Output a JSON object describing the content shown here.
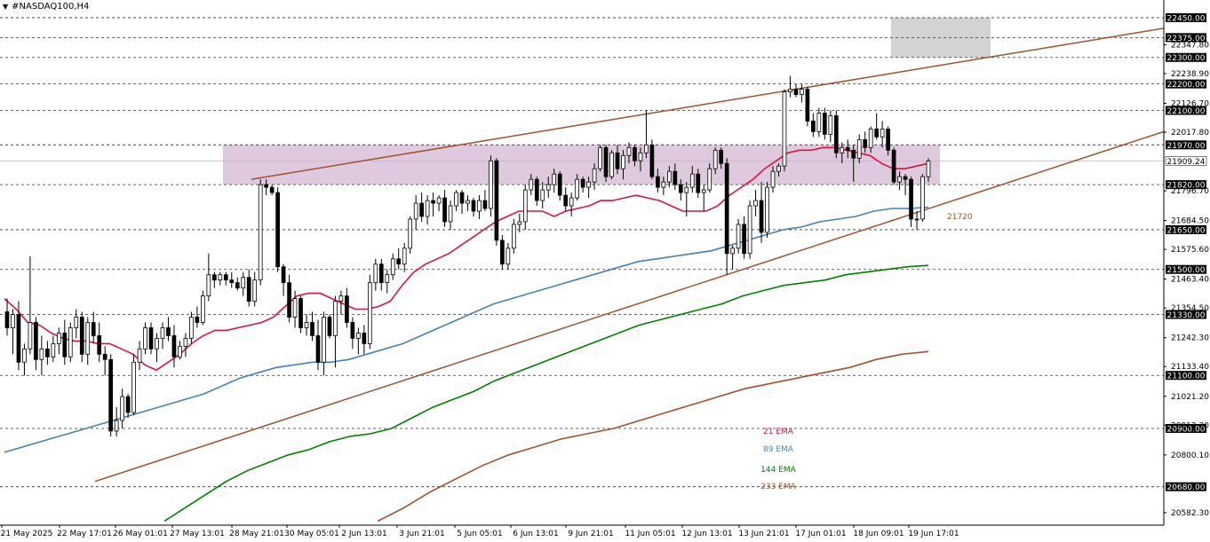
{
  "window": {
    "title": "#NASDAQ100,H4"
  },
  "colors": {
    "bull_fill": "#ffffff",
    "bear_fill": "#000000",
    "candle_line": "#000000",
    "grid": "#333333",
    "ema21": "#dc143c",
    "ema89": "#4682b4",
    "ema144": "#008000",
    "ema233": "#a0522d",
    "channel": "#a0522d",
    "zone_purple": "#d8bfd8",
    "zone_grey": "#d3d3d3",
    "price_box": "#000000"
  },
  "chart_data": {
    "type": "candlestick",
    "title": "#NASDAQ100,H4",
    "ylim": [
      20535,
      22500
    ],
    "y_ticks": [
      "22347.80",
      "22238.90",
      "22126.70",
      "22017.80",
      "21796.70",
      "21684.50",
      "21575.60",
      "21463.40",
      "21354.50",
      "21242.30",
      "21133.40",
      "21021.20",
      "20912.30",
      "20800.10",
      "20582.30"
    ],
    "price_levels": [
      "22450.00",
      "22375.00",
      "22300.00",
      "22200.00",
      "22100.00",
      "21970.00",
      "21820.00",
      "21650.00",
      "21500.00",
      "21330.00",
      "21100.00",
      "20900.00",
      "20680.00"
    ],
    "current_price": "21909.24",
    "x_labels": [
      "21 May 2025",
      "22 May 17:01",
      "26 May 01:01",
      "27 May 13:01",
      "28 May 21:01",
      "30 May 05:01",
      "2 Jun 13:01",
      "3 Jun 21:01",
      "5 Jun 05:01",
      "6 Jun 13:01",
      "9 Jun 21:01",
      "11 Jun 05:01",
      "12 Jun 13:01",
      "13 Jun 21:01",
      "17 Jun 01:01",
      "18 Jun 09:01",
      "19 Jun 17:01"
    ],
    "candles": [
      [
        21340,
        21390,
        21250,
        21280
      ],
      [
        21280,
        21350,
        21180,
        21330
      ],
      [
        21330,
        21380,
        21120,
        21150
      ],
      [
        21150,
        21220,
        21100,
        21200
      ],
      [
        21200,
        21550,
        21180,
        21300
      ],
      [
        21300,
        21320,
        21120,
        21160
      ],
      [
        21160,
        21250,
        21100,
        21200
      ],
      [
        21200,
        21230,
        21140,
        21170
      ],
      [
        21170,
        21250,
        21150,
        21220
      ],
      [
        21220,
        21280,
        21180,
        21260
      ],
      [
        21260,
        21310,
        21140,
        21170
      ],
      [
        21170,
        21300,
        21150,
        21280
      ],
      [
        21280,
        21350,
        21240,
        21320
      ],
      [
        21320,
        21340,
        21150,
        21180
      ],
      [
        21180,
        21320,
        21140,
        21300
      ],
      [
        21300,
        21340,
        21220,
        21250
      ],
      [
        21250,
        21300,
        21150,
        21180
      ],
      [
        21180,
        21210,
        21100,
        21160
      ],
      [
        21160,
        21180,
        20870,
        20890
      ],
      [
        20890,
        20980,
        20870,
        20930
      ],
      [
        20930,
        21050,
        20900,
        21020
      ],
      [
        21020,
        21030,
        20940,
        20960
      ],
      [
        20960,
        21180,
        20950,
        21150
      ],
      [
        21150,
        21230,
        21120,
        21200
      ],
      [
        21200,
        21300,
        21180,
        21280
      ],
      [
        21280,
        21300,
        21180,
        21200
      ],
      [
        21200,
        21260,
        21150,
        21240
      ],
      [
        21240,
        21300,
        21200,
        21280
      ],
      [
        21280,
        21320,
        21230,
        21250
      ],
      [
        21250,
        21290,
        21130,
        21170
      ],
      [
        21170,
        21230,
        21160,
        21210
      ],
      [
        21210,
        21260,
        21170,
        21240
      ],
      [
        21240,
        21340,
        21220,
        21320
      ],
      [
        21320,
        21360,
        21280,
        21300
      ],
      [
        21300,
        21420,
        21290,
        21400
      ],
      [
        21400,
        21560,
        21380,
        21480
      ],
      [
        21480,
        21490,
        21430,
        21460
      ],
      [
        21460,
        21490,
        21440,
        21480
      ],
      [
        21480,
        21490,
        21440,
        21460
      ],
      [
        21460,
        21490,
        21430,
        21450
      ],
      [
        21450,
        21470,
        21420,
        21430
      ],
      [
        21430,
        21490,
        21400,
        21470
      ],
      [
        21470,
        21500,
        21360,
        21380
      ],
      [
        21380,
        21490,
        21360,
        21460
      ],
      [
        21460,
        21840,
        21440,
        21820
      ],
      [
        21820,
        21840,
        21780,
        21810
      ],
      [
        21810,
        21820,
        21780,
        21790
      ],
      [
        21790,
        21810,
        21490,
        21510
      ],
      [
        21510,
        21520,
        21400,
        21450
      ],
      [
        21450,
        21480,
        21300,
        21320
      ],
      [
        21320,
        21420,
        21280,
        21390
      ],
      [
        21390,
        21400,
        21260,
        21280
      ],
      [
        21280,
        21330,
        21250,
        21300
      ],
      [
        21300,
        21340,
        21230,
        21250
      ],
      [
        21250,
        21310,
        21120,
        21150
      ],
      [
        21150,
        21340,
        21100,
        21320
      ],
      [
        21320,
        21330,
        21240,
        21250
      ],
      [
        21250,
        21400,
        21130,
        21380
      ],
      [
        21380,
        21420,
        21330,
        21400
      ],
      [
        21400,
        21430,
        21280,
        21300
      ],
      [
        21300,
        21320,
        21200,
        21240
      ],
      [
        21240,
        21280,
        21180,
        21260
      ],
      [
        21260,
        21290,
        21180,
        21220
      ],
      [
        21220,
        21480,
        21200,
        21450
      ],
      [
        21450,
        21540,
        21420,
        21520
      ],
      [
        21520,
        21540,
        21420,
        21450
      ],
      [
        21450,
        21500,
        21410,
        21480
      ],
      [
        21480,
        21560,
        21460,
        21540
      ],
      [
        21540,
        21580,
        21500,
        21520
      ],
      [
        21520,
        21600,
        21490,
        21580
      ],
      [
        21580,
        21700,
        21560,
        21690
      ],
      [
        21690,
        21780,
        21650,
        21750
      ],
      [
        21750,
        21790,
        21680,
        21700
      ],
      [
        21700,
        21780,
        21670,
        21760
      ],
      [
        21760,
        21790,
        21700,
        21750
      ],
      [
        21750,
        21780,
        21720,
        21770
      ],
      [
        21770,
        21800,
        21660,
        21680
      ],
      [
        21680,
        21760,
        21650,
        21740
      ],
      [
        21740,
        21800,
        21720,
        21790
      ],
      [
        21790,
        21800,
        21710,
        21750
      ],
      [
        21750,
        21780,
        21720,
        21760
      ],
      [
        21760,
        21770,
        21700,
        21720
      ],
      [
        21720,
        21780,
        21690,
        21760
      ],
      [
        21760,
        21800,
        21720,
        21730
      ],
      [
        21730,
        21930,
        21700,
        21910
      ],
      [
        21910,
        21920,
        21590,
        21610
      ],
      [
        21610,
        21630,
        21500,
        21520
      ],
      [
        21520,
        21600,
        21500,
        21580
      ],
      [
        21580,
        21690,
        21560,
        21670
      ],
      [
        21670,
        21710,
        21640,
        21680
      ],
      [
        21680,
        21820,
        21650,
        21800
      ],
      [
        21800,
        21860,
        21780,
        21840
      ],
      [
        21840,
        21850,
        21740,
        21760
      ],
      [
        21760,
        21830,
        21730,
        21800
      ],
      [
        21800,
        21850,
        21770,
        21820
      ],
      [
        21820,
        21880,
        21790,
        21860
      ],
      [
        21860,
        21870,
        21760,
        21780
      ],
      [
        21780,
        21810,
        21720,
        21740
      ],
      [
        21740,
        21790,
        21700,
        21770
      ],
      [
        21770,
        21860,
        21760,
        21840
      ],
      [
        21840,
        21850,
        21790,
        21810
      ],
      [
        21810,
        21850,
        21770,
        21830
      ],
      [
        21830,
        21900,
        21800,
        21880
      ],
      [
        21880,
        21970,
        21870,
        21960
      ],
      [
        21960,
        21970,
        21830,
        21850
      ],
      [
        21850,
        21950,
        21840,
        21940
      ],
      [
        21940,
        21970,
        21860,
        21880
      ],
      [
        21880,
        21950,
        21840,
        21930
      ],
      [
        21930,
        21980,
        21900,
        21960
      ],
      [
        21960,
        21970,
        21890,
        21910
      ],
      [
        21910,
        21960,
        21870,
        21940
      ],
      [
        21940,
        22100,
        21920,
        21970
      ],
      [
        21970,
        21990,
        21840,
        21850
      ],
      [
        21850,
        21880,
        21790,
        21810
      ],
      [
        21810,
        21850,
        21780,
        21830
      ],
      [
        21830,
        21890,
        21810,
        21870
      ],
      [
        21870,
        21900,
        21800,
        21820
      ],
      [
        21820,
        21840,
        21760,
        21790
      ],
      [
        21790,
        21830,
        21700,
        21810
      ],
      [
        21810,
        21890,
        21790,
        21860
      ],
      [
        21860,
        21880,
        21770,
        21790
      ],
      [
        21790,
        21820,
        21720,
        21800
      ],
      [
        21800,
        21900,
        21790,
        21880
      ],
      [
        21880,
        21960,
        21860,
        21950
      ],
      [
        21950,
        21960,
        21880,
        21900
      ],
      [
        21900,
        21920,
        21480,
        21560
      ],
      [
        21560,
        21590,
        21500,
        21580
      ],
      [
        21580,
        21690,
        21560,
        21670
      ],
      [
        21670,
        21700,
        21540,
        21560
      ],
      [
        21560,
        21760,
        21540,
        21740
      ],
      [
        21740,
        21800,
        21700,
        21760
      ],
      [
        21760,
        21830,
        21600,
        21640
      ],
      [
        21640,
        21830,
        21620,
        21810
      ],
      [
        21810,
        21890,
        21790,
        21870
      ],
      [
        21870,
        21900,
        21850,
        21890
      ],
      [
        21890,
        22180,
        21870,
        22170
      ],
      [
        22170,
        22230,
        22150,
        22180
      ],
      [
        22180,
        22200,
        22150,
        22160
      ],
      [
        22160,
        22200,
        22130,
        22180
      ],
      [
        22180,
        22190,
        22040,
        22060
      ],
      [
        22060,
        22090,
        22000,
        22020
      ],
      [
        22020,
        22110,
        22000,
        22090
      ],
      [
        22090,
        22110,
        21990,
        22010
      ],
      [
        22010,
        22100,
        21980,
        22080
      ],
      [
        22080,
        22100,
        21920,
        21940
      ],
      [
        21940,
        21980,
        21900,
        21960
      ],
      [
        21960,
        21990,
        21920,
        21950
      ],
      [
        21950,
        21970,
        21830,
        21920
      ],
      [
        21920,
        22010,
        21900,
        21990
      ],
      [
        21990,
        22020,
        21940,
        21960
      ],
      [
        21960,
        22040,
        21940,
        22030
      ],
      [
        22030,
        22090,
        21990,
        22000
      ],
      [
        22000,
        22060,
        21960,
        22030
      ],
      [
        22030,
        22040,
        21930,
        21950
      ],
      [
        21950,
        21960,
        21820,
        21830
      ],
      [
        21830,
        21870,
        21800,
        21850
      ],
      [
        21850,
        21860,
        21780,
        21840
      ],
      [
        21840,
        21850,
        21660,
        21690
      ],
      [
        21690,
        21720,
        21650,
        21690
      ],
      [
        21690,
        21860,
        21680,
        21850
      ],
      [
        21850,
        21920,
        21830,
        21909
      ]
    ],
    "ema21": [
      21390,
      21350,
      21300,
      21290,
      21260,
      21240,
      21230,
      21230,
      21220,
      21220,
      21200,
      21180,
      21140,
      21120,
      21150,
      21180,
      21220,
      21250,
      21270,
      21270,
      21280,
      21290,
      21300,
      21320,
      21360,
      21400,
      21410,
      21410,
      21390,
      21370,
      21350,
      21350,
      21360,
      21380,
      21440,
      21490,
      21520,
      21540,
      21560,
      21590,
      21620,
      21650,
      21680,
      21700,
      21720,
      21720,
      21720,
      21700,
      21720,
      21730,
      21740,
      21760,
      21760,
      21770,
      21780,
      21770,
      21760,
      21740,
      21720,
      21720,
      21720,
      21740,
      21780,
      21810,
      21840,
      21880,
      21910,
      21940,
      21950,
      21950,
      21960,
      21960,
      21950,
      21940,
      21930,
      21900,
      21880,
      21880,
      21890,
      21900
    ],
    "ema89": [
      20810,
      20830,
      20850,
      20870,
      20890,
      20910,
      20930,
      20950,
      20970,
      20990,
      21010,
      21030,
      21060,
      21090,
      21110,
      21130,
      21140,
      21150,
      21150,
      21160,
      21180,
      21200,
      21220,
      21250,
      21280,
      21310,
      21340,
      21370,
      21390,
      21410,
      21430,
      21450,
      21470,
      21490,
      21510,
      21530,
      21540,
      21550,
      21560,
      21570,
      21590,
      21610,
      21630,
      21650,
      21660,
      21680,
      21690,
      21700,
      21720,
      21730,
      21730,
      21735
    ],
    "ema144": [
      20550,
      20600,
      20650,
      20700,
      20740,
      20770,
      20800,
      20820,
      20850,
      20870,
      20880,
      20900,
      20940,
      20980,
      21010,
      21040,
      21080,
      21110,
      21140,
      21170,
      21200,
      21230,
      21260,
      21290,
      21310,
      21330,
      21350,
      21370,
      21400,
      21420,
      21440,
      21450,
      21460,
      21480,
      21490,
      21500,
      21510,
      21515
    ],
    "ema233": [
      20550,
      20600,
      20660,
      20710,
      20760,
      20800,
      20830,
      20860,
      20880,
      20900,
      20930,
      20960,
      20990,
      21020,
      21050,
      21070,
      21090,
      21110,
      21130,
      21160,
      21180,
      21190
    ],
    "annotations": [
      "21720"
    ],
    "legend": [
      {
        "name": "21 EMA",
        "color": "#dc143c"
      },
      {
        "name": "89 EMA",
        "color": "#4682b4"
      },
      {
        "name": "144 EMA",
        "color": "#008000"
      },
      {
        "name": "233 EMA",
        "color": "#a0522d"
      }
    ]
  }
}
